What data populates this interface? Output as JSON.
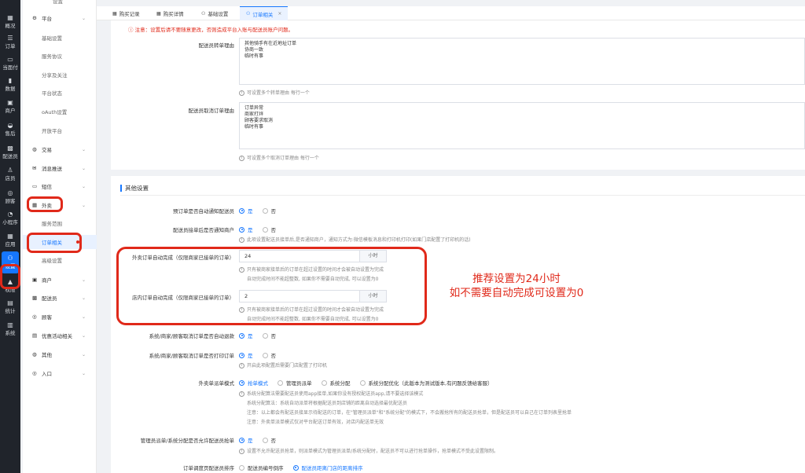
{
  "rail": [
    {
      "icon": "▦",
      "label": "概况"
    },
    {
      "icon": "☰",
      "label": "订单"
    },
    {
      "icon": "▭",
      "label": "当面付"
    },
    {
      "icon": "▮",
      "label": "数据"
    },
    {
      "icon": "▣",
      "label": "商户"
    },
    {
      "icon": "◒",
      "label": "售后"
    },
    {
      "icon": "▩",
      "label": "配送员"
    },
    {
      "icon": "♙",
      "label": "店员"
    },
    {
      "icon": "◎",
      "label": "顾客"
    },
    {
      "icon": "◔",
      "label": "小程序"
    },
    {
      "icon": "▦",
      "label": "应用"
    },
    {
      "icon": "⚇",
      "label": "设置"
    },
    {
      "icon": "▲",
      "label": "权限"
    },
    {
      "icon": "▤",
      "label": "统计"
    },
    {
      "icon": "▥",
      "label": "系统"
    }
  ],
  "submenu": {
    "header": "设置",
    "items": [
      {
        "kind": "group",
        "icon": "⚙",
        "label": "平台"
      },
      {
        "kind": "child",
        "label": "基础设置"
      },
      {
        "kind": "child",
        "label": "服务协议"
      },
      {
        "kind": "child",
        "label": "分享及关注"
      },
      {
        "kind": "child",
        "label": "平台状态"
      },
      {
        "kind": "child",
        "label": "oAuth设置"
      },
      {
        "kind": "child",
        "label": "开放平台"
      },
      {
        "kind": "group",
        "icon": "◍",
        "label": "交易"
      },
      {
        "kind": "group",
        "icon": "✉",
        "label": "消息推送"
      },
      {
        "kind": "group",
        "icon": "▭",
        "label": "短信"
      },
      {
        "kind": "group",
        "icon": "▦",
        "label": "外卖"
      },
      {
        "kind": "child",
        "label": "服务范围"
      },
      {
        "kind": "child",
        "label": "订单相关"
      },
      {
        "kind": "child",
        "label": "高级设置"
      },
      {
        "kind": "group",
        "icon": "▣",
        "label": "商户"
      },
      {
        "kind": "group",
        "icon": "▩",
        "label": "配送员"
      },
      {
        "kind": "group",
        "icon": "◎",
        "label": "顾客"
      },
      {
        "kind": "group",
        "icon": "▤",
        "label": "优惠活动相关"
      },
      {
        "kind": "group",
        "icon": "◍",
        "label": "其他"
      },
      {
        "kind": "group",
        "icon": "◎",
        "label": "入口"
      }
    ]
  },
  "tabs": [
    {
      "icon": "▦",
      "label": "购买记录"
    },
    {
      "icon": "▦",
      "label": "购买详情"
    },
    {
      "icon": "⚇",
      "label": "基础设置"
    },
    {
      "icon": "⚇",
      "label": "订单相关",
      "close": "×"
    }
  ],
  "notice": "ⓘ 注意：设置后请不要随意更改，否则造成平台入账与配送员账户问题。",
  "reason_transfer": {
    "label": "配送员转单理由",
    "lines": [
      "其他骑手有在近地址订单",
      "协商一致",
      "临时有事"
    ],
    "hint": "可设置多个转单理由 每行一个"
  },
  "reason_cancel": {
    "label": "配送员取消订单理由",
    "lines": [
      "订单异常",
      "商家打烊",
      "顾客要求取消",
      "临时有事"
    ],
    "hint": "可设置多个取消订单理由 每行一个"
  },
  "section_title": "其他设置",
  "yes": "是",
  "no": "否",
  "notify_dispatcher": {
    "label": "预订单是否自动通知配送员"
  },
  "notify_merchant": {
    "label": "配送员接单后是否通知商户",
    "hint": "此项设置配送员接单后,是否通知商户，通知方式为:微信模板消息和打印机打印(如果门店配置了打印机的话)"
  },
  "auto_complete_takeout": {
    "label": "外卖订单自动完成（仅限商家已接单的订单）",
    "value": "24",
    "unit": "小时",
    "hint1": "只有被商家接单后的订单在超过设置的时间才会被自动设置为完成",
    "hint2": "自动完成时间不能超整数, 如果你不需要自动完成, 可以设置为0"
  },
  "auto_complete_store": {
    "label": "店内订单自动完成（仅限商家已接单的订单）",
    "value": "2",
    "unit": "小时",
    "hint1": "只有被商家接单后的订单在超过设置的时间才会被自动设置为完成",
    "hint2": "自动完成时间不能超整数, 如果你不需要自动完成, 可以设置为0"
  },
  "annotation": {
    "line1": "推荐设置为24小时",
    "line2": "如不需要自动完成可设置为0"
  },
  "cancel_refund": {
    "label": "系统/商家/顾客取消订单是否自动退款"
  },
  "cancel_print": {
    "label": "系统/商家/顾客取消订单是否打印订单",
    "hint": "开启此项配置后需要门店配置了打印机"
  },
  "dispatch_mode": {
    "label": "外卖单派单模式",
    "options": [
      "抢单模式",
      "管理员派单",
      "系统分配",
      "系统分配优化（此版本为测试版本,有问题反馈给客服）"
    ],
    "hint1": "系统分配算法需要配送员使用app接单,如果你没有授权配送员app,请不要选择该模式",
    "hint2": "系统分配算法：系统自动派单将根据配送员到店铺的距离自动选择最优配送员",
    "hint3": "注意：以上都会有配送员接显示待配送的订单，在\"管理员派单\"和\"系统分配\"的模式下，不会搬抢所有的配送员抢单，但是配送员可以自己在订单列表里抢单",
    "hint4": "注意：外卖单派单模式仅对平台配送订单有效，对店内配送单无效"
  },
  "allow_grab": {
    "label": "管理员派单/系统分配是否允许配送员抢单",
    "hint": "设置不允许配送员抢单，则派单模式为管理员派单/系统分配时，配送员不可以进行抢单操作，抢单模式不受此设置限制。"
  },
  "dispatch_sort": {
    "label": "订单调度页配送员排序",
    "options": [
      "配送员编号倒序",
      "配送员距离门店的距离排序"
    ]
  }
}
